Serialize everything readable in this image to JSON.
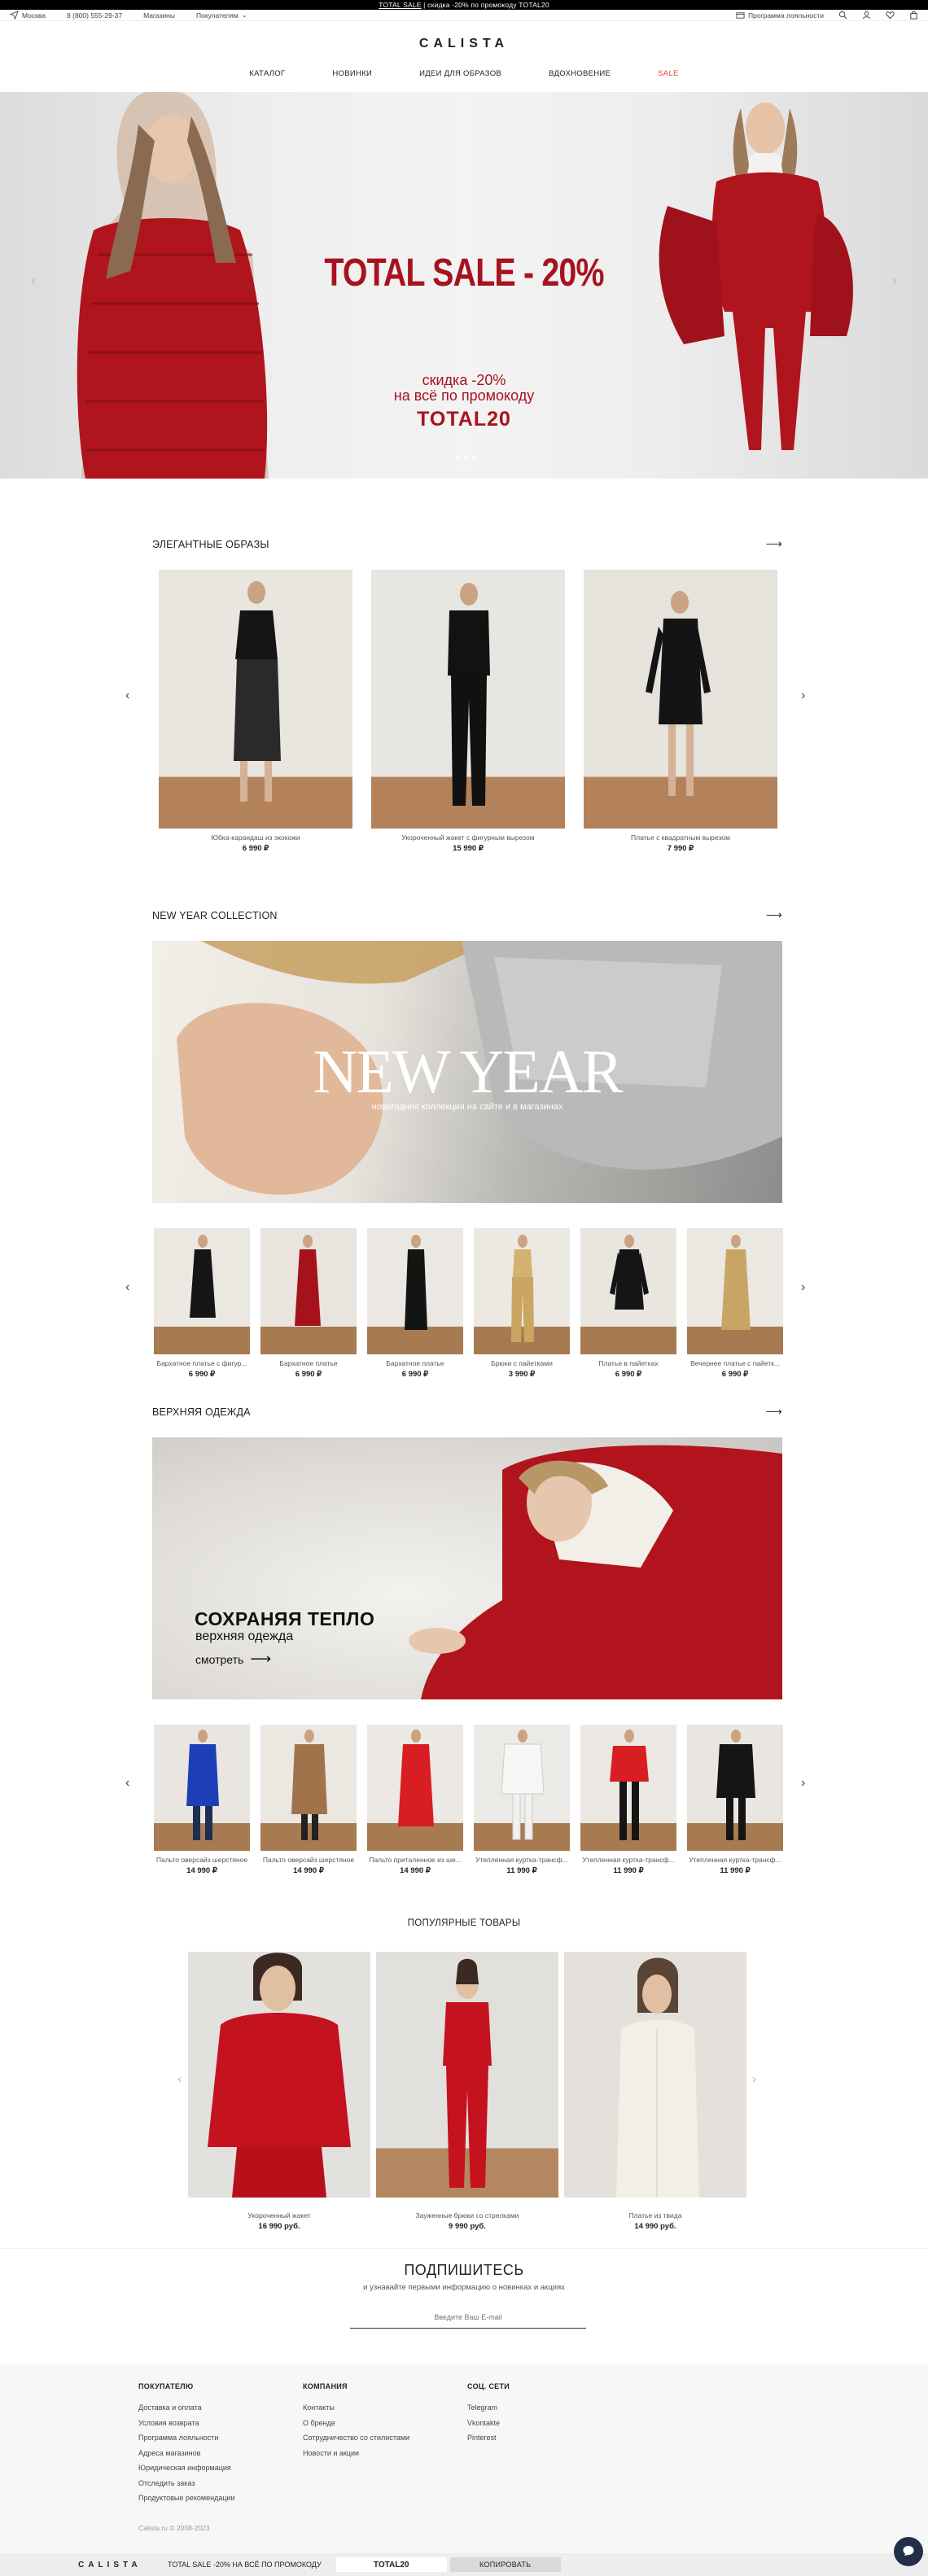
{
  "promo_bar": {
    "link": "TOTAL SALE",
    "text": " | скидка -20% по промокоду TOTAL20"
  },
  "utility": {
    "city": "Москва",
    "phone": "8 (800) 555-29-37",
    "stores": "Магазины",
    "buyers": "Покупателям",
    "loyalty": "Программа лояльности"
  },
  "header": {
    "logo": "CALISTA",
    "nav": [
      "КАТАЛОГ",
      "НОВИНКИ",
      "ИДЕИ ДЛЯ ОБРАЗОВ",
      "ВДОХНОВЕНИЕ",
      "SALE"
    ]
  },
  "hero": {
    "title": "TOTAL SALE - 20%",
    "subtitle_1": "скидка -20%",
    "subtitle_2": "на всё по промокоду",
    "code": "TOTAL20",
    "prev": "‹",
    "next": "›"
  },
  "elegant": {
    "title": "ЭЛЕГАНТНЫЕ ОБРАЗЫ",
    "items": [
      {
        "name": "Юбка-карандаш из экокожи",
        "price": "6 990 ₽"
      },
      {
        "name": "Укороченный жакет с фигурным вырезом",
        "price": "15 990 ₽"
      },
      {
        "name": "Платье с квадратным вырезом",
        "price": "7 990 ₽"
      }
    ]
  },
  "newyear": {
    "title": "NEW YEAR COLLECTION",
    "banner_title": "NEW YEAR",
    "banner_sub": "новогодняя коллекция на сайте и в магазинах",
    "items": [
      {
        "name": "Бархатное платье с фигур...",
        "price": "6 990 ₽"
      },
      {
        "name": "Бархатное платье",
        "price": "6 990 ₽"
      },
      {
        "name": "Бархатное платье",
        "price": "6 990 ₽"
      },
      {
        "name": "Брюки с пайетками",
        "price": "3 990 ₽"
      },
      {
        "name": "Платье в пайетках",
        "price": "6 990 ₽"
      },
      {
        "name": "Вечернее платье с пайетк...",
        "price": "6 990 ₽"
      }
    ]
  },
  "outer": {
    "title": "ВЕРХНЯЯ ОДЕЖДА",
    "banner_title": "СОХРАНЯЯ ТЕПЛО",
    "banner_sub": "верхняя одежда",
    "banner_link": "смотреть",
    "items": [
      {
        "name": "Пальто оверсайз шерстяное",
        "price": "14 990 ₽"
      },
      {
        "name": "Пальто оверсайз шерстяное",
        "price": "14 990 ₽"
      },
      {
        "name": "Пальто приталенное из ше...",
        "price": "14 990 ₽"
      },
      {
        "name": "Утепленная куртка-трансф...",
        "price": "11 990 ₽"
      },
      {
        "name": "Утепленная куртка-трансф...",
        "price": "11 990 ₽"
      },
      {
        "name": "Утепленная куртка-трансф...",
        "price": "11 990 ₽"
      }
    ]
  },
  "popular": {
    "title": "ПОПУЛЯРНЫЕ ТОВАРЫ",
    "items": [
      {
        "name": "Укороченный жакет",
        "price": "16 990 руб."
      },
      {
        "name": "Зауженные брюки со стрелками",
        "price": "9 990 руб."
      },
      {
        "name": "Платье из твида",
        "price": "14 990 руб."
      }
    ]
  },
  "subscribe": {
    "title": "ПОДПИШИТЕСЬ",
    "text": "и узнавайте первыми информацию о новинках и акциях",
    "placeholder": "Введите Ваш E-mail"
  },
  "footer": {
    "col1": {
      "title": "ПОКУПАТЕЛЮ",
      "links": [
        "Доставка и оплата",
        "Условия возврата",
        "Программа лояльности",
        "Адреса магазинов",
        "Юридическая информация",
        "Отследить заказ",
        "Продуктовые рекомендации"
      ]
    },
    "col2": {
      "title": "КОМПАНИЯ",
      "links": [
        "Контакты",
        "О бренде",
        "Сотрудничество со стилистами",
        "Новости и акции"
      ]
    },
    "col3": {
      "title": "СОЦ. СЕТИ",
      "links": [
        "Telegram",
        "Vkontakte",
        "Pinterest"
      ]
    },
    "copyright": "Calista.ru © 2008-2023"
  },
  "sticky": {
    "logo": "CALISTA",
    "text": "TOTAL SALE -20% НА ВСЁ ПО ПРОМОКОДУ",
    "code": "TOTAL20",
    "copy": "КОПИРОВАТЬ"
  },
  "colors": {
    "accent_red": "#a8121f",
    "sale_nav": "#e0462e",
    "chat": "#223047"
  }
}
